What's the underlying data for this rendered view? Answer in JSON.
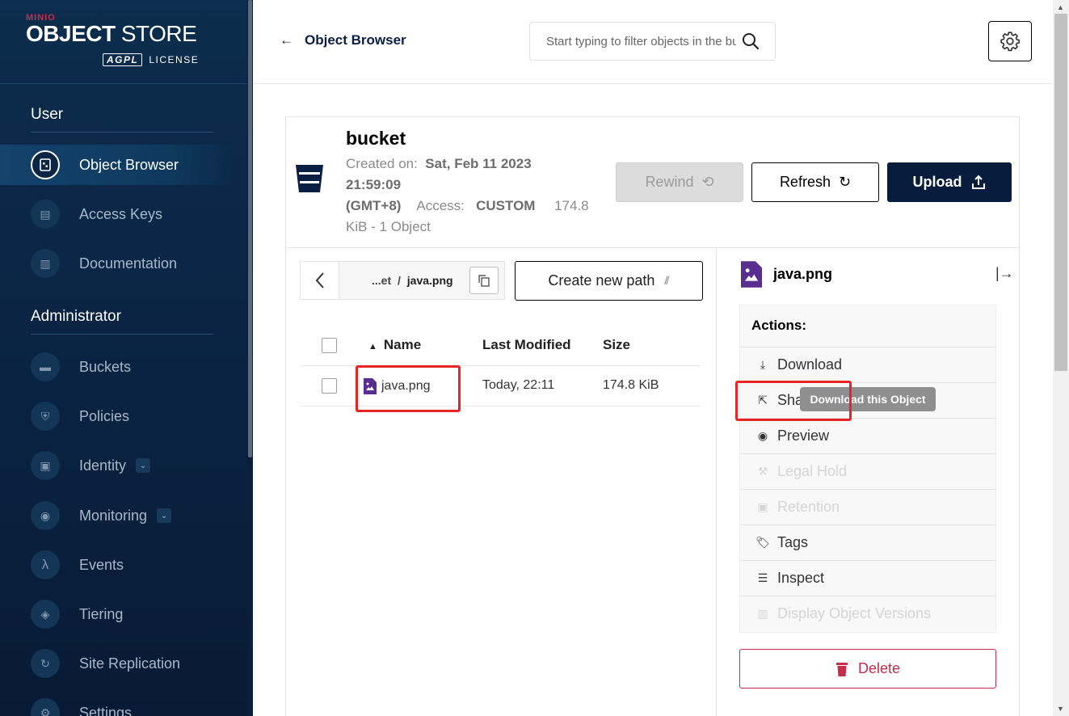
{
  "brand": {
    "minio": "MINIO",
    "object": "OBJECT",
    "store": "STORE",
    "agpl": "AGPL",
    "license": "LICENSE"
  },
  "sidebar": {
    "sections": [
      {
        "title": "User"
      },
      {
        "title": "Administrator"
      }
    ],
    "user_items": [
      {
        "label": "Object Browser",
        "icon": "object-browser-icon",
        "active": true
      },
      {
        "label": "Access Keys",
        "icon": "key-icon"
      },
      {
        "label": "Documentation",
        "icon": "document-icon"
      }
    ],
    "admin_items": [
      {
        "label": "Buckets",
        "icon": "bucket-icon"
      },
      {
        "label": "Policies",
        "icon": "shield-icon"
      },
      {
        "label": "Identity",
        "icon": "id-card-icon",
        "expandable": true
      },
      {
        "label": "Monitoring",
        "icon": "monitoring-icon",
        "expandable": true
      },
      {
        "label": "Events",
        "icon": "lambda-icon"
      },
      {
        "label": "Tiering",
        "icon": "layers-icon"
      },
      {
        "label": "Site Replication",
        "icon": "replication-icon"
      },
      {
        "label": "Settings",
        "icon": "settings-icon"
      }
    ]
  },
  "header": {
    "back_label": "Object Browser",
    "search_placeholder": "Start typing to filter objects in the bucket"
  },
  "bucket": {
    "name": "bucket",
    "created_label": "Created on:",
    "created_value_1": "Sat, Feb 11 2023",
    "created_value_2": "21:59:09",
    "created_value_3": "(GMT+8)",
    "access_label": "Access:",
    "access_value": "CUSTOM",
    "size_1": "174.8",
    "size_2": "KiB - 1 Object"
  },
  "buttons": {
    "rewind": "Rewind",
    "refresh": "Refresh",
    "upload": "Upload",
    "create_path": "Create new path",
    "delete": "Delete"
  },
  "breadcrumb": {
    "prefix": "...et",
    "sep": "/",
    "file": "java.png"
  },
  "table": {
    "columns": [
      "Name",
      "Last Modified",
      "Size"
    ],
    "rows": [
      {
        "name": "java.png",
        "modified": "Today, 22:11",
        "size": "174.8 KiB"
      }
    ]
  },
  "panel": {
    "file_name": "java.png",
    "actions_title": "Actions:",
    "actions": [
      {
        "label": "Download",
        "icon": "download-icon",
        "enabled": true
      },
      {
        "label": "Share",
        "icon": "share-icon",
        "enabled": true
      },
      {
        "label": "Preview",
        "icon": "eye-icon",
        "enabled": true
      },
      {
        "label": "Legal Hold",
        "icon": "gavel-icon",
        "enabled": false
      },
      {
        "label": "Retention",
        "icon": "retention-icon",
        "enabled": false
      },
      {
        "label": "Tags",
        "icon": "tag-icon",
        "enabled": true
      },
      {
        "label": "Inspect",
        "icon": "inspect-icon",
        "enabled": true
      },
      {
        "label": "Display Object Versions",
        "icon": "versions-icon",
        "enabled": false
      }
    ]
  },
  "tooltip": "Download this Object",
  "colors": {
    "sidebar": "#0b2545",
    "upload_bg": "#081c3e",
    "delete": "#c72c48",
    "highlight": "#e82424",
    "file_icon": "#5a2d91"
  }
}
